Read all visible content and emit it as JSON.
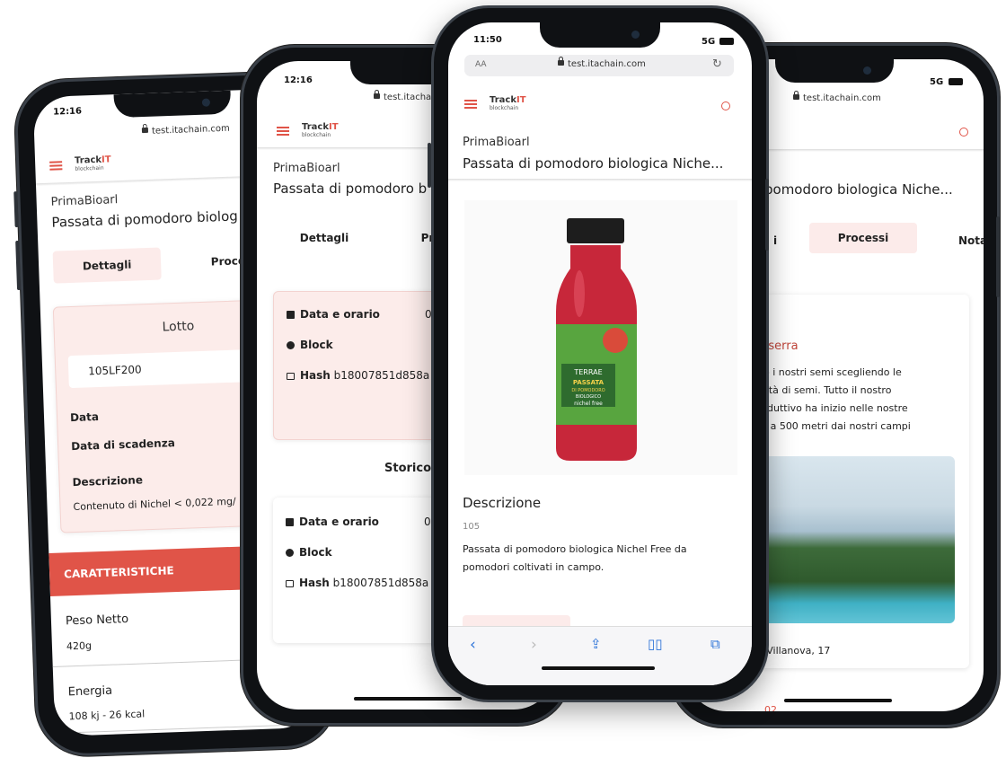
{
  "url": "test.itachain.com",
  "brand": {
    "name": "Track",
    "suffix": "IT",
    "tagline": "blockchain"
  },
  "company": "PrimaBioarl",
  "product_title": "Passata di pomodoro biologica Niche...",
  "product_title_cut_1": "Passata di pomodoro biolog",
  "product_title_cut_2": "Passata di pomodoro b",
  "product_title_cut_4": "pomodoro biologica Niche...",
  "status": {
    "time_a": "12:16",
    "time_b": "11:50",
    "network": "5G",
    "aa": "AA"
  },
  "tabs": {
    "details": "Dettagli",
    "processes": "Processi",
    "processes_cut": "Pr",
    "notes_cut": "Nota",
    "details_cut": "i"
  },
  "phone1": {
    "lot_heading": "Lotto",
    "lot_value": "105LF200",
    "date_label": "Data",
    "expiry_label": "Data di scadenza",
    "description_label": "Descrizione",
    "description_value": "Contenuto di Nichel < 0,022 mg/",
    "characteristics": "CARATTERISTICHE",
    "weight_label": "Peso Netto",
    "weight_value": "420g",
    "energy_label": "Energia",
    "energy_value": "108 kj - 26 kcal"
  },
  "phone2": {
    "date_time_label": "Data e orario",
    "date_time_value": "0",
    "block_label": "Block",
    "hash_label": "Hash",
    "hash_value": "b18007851d858a",
    "history_label": "Storico"
  },
  "phone3": {
    "description_heading": "Descrizione",
    "code": "105",
    "description_text_1": "Passata di pomodoro biologica Nichel Free da",
    "description_text_2": "pomodori coltivati in campo.",
    "label_brand": "TERRAE",
    "label_line1": "PASSATA",
    "label_line2": "DI POMODORO",
    "label_line3": "BIOLOGICO",
    "label_line4": "nichel free"
  },
  "phone4": {
    "process_title": "n serra",
    "text_1": "no i nostri semi scegliendo le",
    "text_2": "alità di semi. Tutto il nostro",
    "text_3": "roduttivo ha inizio nelle nostre",
    "text_4": "te a 500 metri dai nostri campi",
    "address": "a Villanova, 17",
    "number": "02"
  },
  "colors": {
    "accent": "#e05448",
    "tab_bg": "#fcebea",
    "ios_blue": "#2b72d8"
  }
}
